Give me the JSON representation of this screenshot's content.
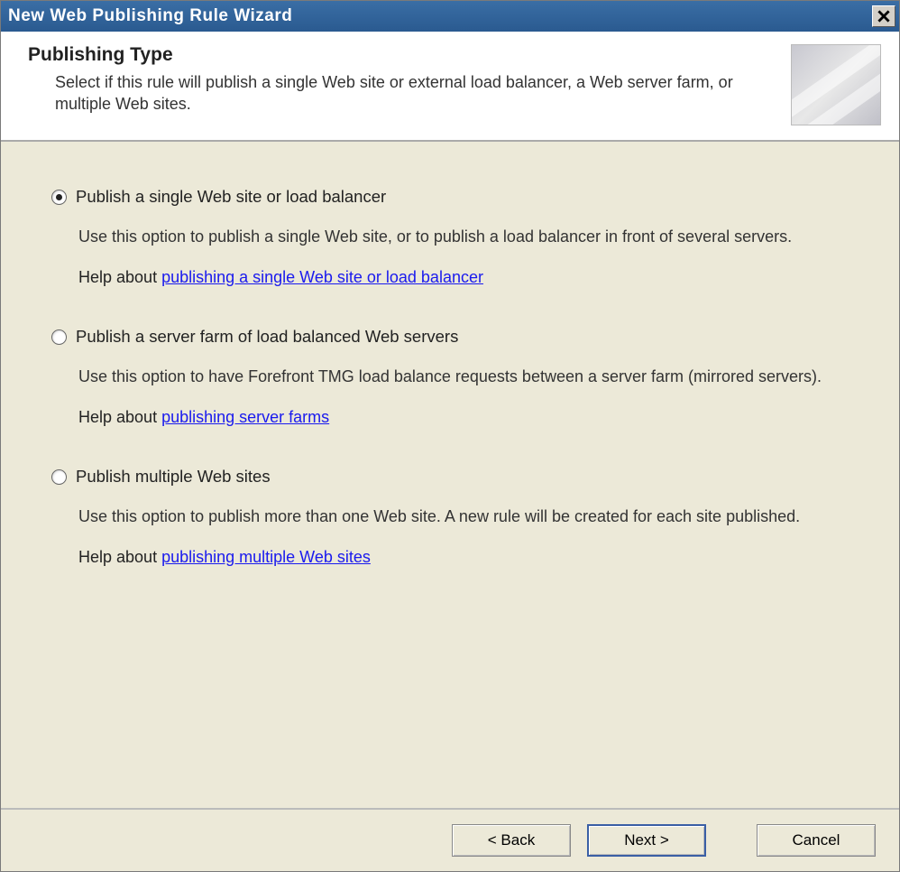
{
  "window": {
    "title": "New Web Publishing Rule Wizard"
  },
  "header": {
    "title": "Publishing Type",
    "subtitle": "Select if this rule will publish a single Web site or external load balancer, a Web server farm, or multiple Web sites."
  },
  "options": [
    {
      "label": "Publish a single Web site or load balancer",
      "selected": true,
      "description": "Use this option to publish a single Web site, or to publish a load balancer in front of several servers.",
      "help_prefix": "Help about ",
      "help_link": "publishing a single Web site or load balancer"
    },
    {
      "label": "Publish a server farm of load balanced Web servers",
      "selected": false,
      "description": "Use this option to have Forefront TMG load balance requests between a server farm (mirrored servers).",
      "help_prefix": "Help about ",
      "help_link": "publishing server farms"
    },
    {
      "label": "Publish multiple Web sites",
      "selected": false,
      "description": "Use this option to publish more than one Web site. A new rule will be created for each site published.",
      "help_prefix": "Help about ",
      "help_link": "publishing multiple Web sites"
    }
  ],
  "buttons": {
    "back": "< Back",
    "next": "Next >",
    "cancel": "Cancel"
  }
}
